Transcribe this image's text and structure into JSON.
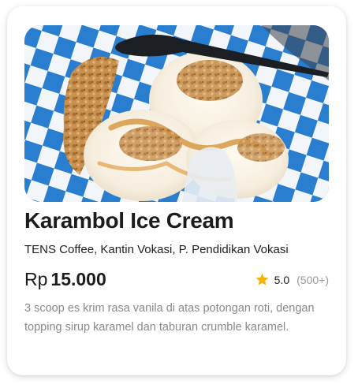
{
  "card": {
    "image_alt": "Karambol Ice Cream",
    "title": "Karambol Ice Cream",
    "location": "TENS Coffee, Kantin Vokasi, P. Pendidikan Vokasi",
    "price": {
      "currency": "Rp",
      "amount": "15.000"
    },
    "rating": {
      "icon": "star-icon",
      "score": "5.0",
      "count": "(500+)"
    },
    "description": "3 scoop es krim rasa vanila di atas potongan roti, dengan topping sirup karamel dan taburan crumble karamel."
  },
  "colors": {
    "title_text": "#1c1c1c",
    "secondary_text": "#8a8a8a",
    "count_text": "#9a9a9a",
    "star": "#f5b400",
    "checker_blue": "#2a7ed0",
    "checker_white": "#f2f6fb"
  }
}
